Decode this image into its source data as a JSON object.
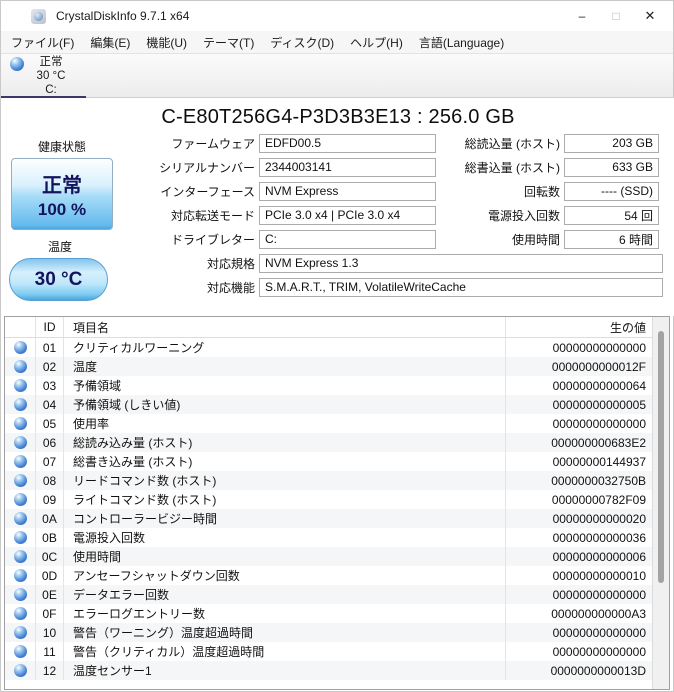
{
  "window": {
    "title": "CrystalDiskInfo 9.7.1 x64",
    "icons": {
      "minimize": "–",
      "maximize": "□",
      "close": "✕"
    }
  },
  "menu": {
    "items": [
      {
        "label": "ファイル(F)"
      },
      {
        "label": "編集(E)"
      },
      {
        "label": "機能(U)"
      },
      {
        "label": "テーマ(T)"
      },
      {
        "label": "ディスク(D)"
      },
      {
        "label": "ヘルプ(H)"
      },
      {
        "label": "言語(Language)"
      }
    ]
  },
  "disk_tab": {
    "status": "正常",
    "temperature": "30 °C",
    "drive": "C:"
  },
  "disk_title": "C-E80T256G4-P3D3B3E13 : 256.0 GB",
  "health": {
    "label": "健康状態",
    "status": "正常",
    "percent": "100 %"
  },
  "temperature": {
    "label": "温度",
    "value": "30 °C"
  },
  "fields_left": [
    {
      "label": "ファームウェア",
      "value": "EDFD00.5"
    },
    {
      "label": "シリアルナンバー",
      "value": "2344003141"
    },
    {
      "label": "インターフェース",
      "value": "NVM Express"
    },
    {
      "label": "対応転送モード",
      "value": "PCIe 3.0 x4 | PCIe 3.0 x4"
    },
    {
      "label": "ドライブレター",
      "value": "C:"
    }
  ],
  "fields_right": [
    {
      "label": "総読込量 (ホスト)",
      "value": "203 GB"
    },
    {
      "label": "総書込量 (ホスト)",
      "value": "633 GB"
    },
    {
      "label": "回転数",
      "value": "---- (SSD)"
    },
    {
      "label": "電源投入回数",
      "value": "54 回"
    },
    {
      "label": "使用時間",
      "value": "6 時間"
    }
  ],
  "fields_wide": [
    {
      "label": "対応規格",
      "value": "NVM Express 1.3"
    },
    {
      "label": "対応機能",
      "value": "S.M.A.R.T., TRIM, VolatileWriteCache"
    }
  ],
  "smart_table": {
    "headers": {
      "id": "ID",
      "name": "項目名",
      "raw": "生の値"
    },
    "rows": [
      {
        "id": "01",
        "name": "クリティカルワーニング",
        "raw": "00000000000000"
      },
      {
        "id": "02",
        "name": "温度",
        "raw": "0000000000012F"
      },
      {
        "id": "03",
        "name": "予備領域",
        "raw": "00000000000064"
      },
      {
        "id": "04",
        "name": "予備領域 (しきい値)",
        "raw": "00000000000005"
      },
      {
        "id": "05",
        "name": "使用率",
        "raw": "00000000000000"
      },
      {
        "id": "06",
        "name": "総読み込み量 (ホスト)",
        "raw": "000000000683E2"
      },
      {
        "id": "07",
        "name": "総書き込み量 (ホスト)",
        "raw": "00000000144937"
      },
      {
        "id": "08",
        "name": "リードコマンド数 (ホスト)",
        "raw": "0000000032750B"
      },
      {
        "id": "09",
        "name": "ライトコマンド数 (ホスト)",
        "raw": "00000000782F09"
      },
      {
        "id": "0A",
        "name": "コントローラービジー時間",
        "raw": "00000000000020"
      },
      {
        "id": "0B",
        "name": "電源投入回数",
        "raw": "00000000000036"
      },
      {
        "id": "0C",
        "name": "使用時間",
        "raw": "00000000000006"
      },
      {
        "id": "0D",
        "name": "アンセーフシャットダウン回数",
        "raw": "00000000000010"
      },
      {
        "id": "0E",
        "name": "データエラー回数",
        "raw": "00000000000000"
      },
      {
        "id": "0F",
        "name": "エラーログエントリー数",
        "raw": "000000000000A3"
      },
      {
        "id": "10",
        "name": "警告（ワーニング）温度超過時間",
        "raw": "00000000000000"
      },
      {
        "id": "11",
        "name": "警告（クリティカル）温度超過時間",
        "raw": "00000000000000"
      },
      {
        "id": "12",
        "name": "温度センサー1",
        "raw": "0000000000013D"
      }
    ]
  },
  "colors": {
    "accent_tab_underline": "#40356a",
    "health_good_blue": "#49a5e0",
    "orb_blue": "#1f4f9e",
    "text_navy": "#14145e"
  }
}
